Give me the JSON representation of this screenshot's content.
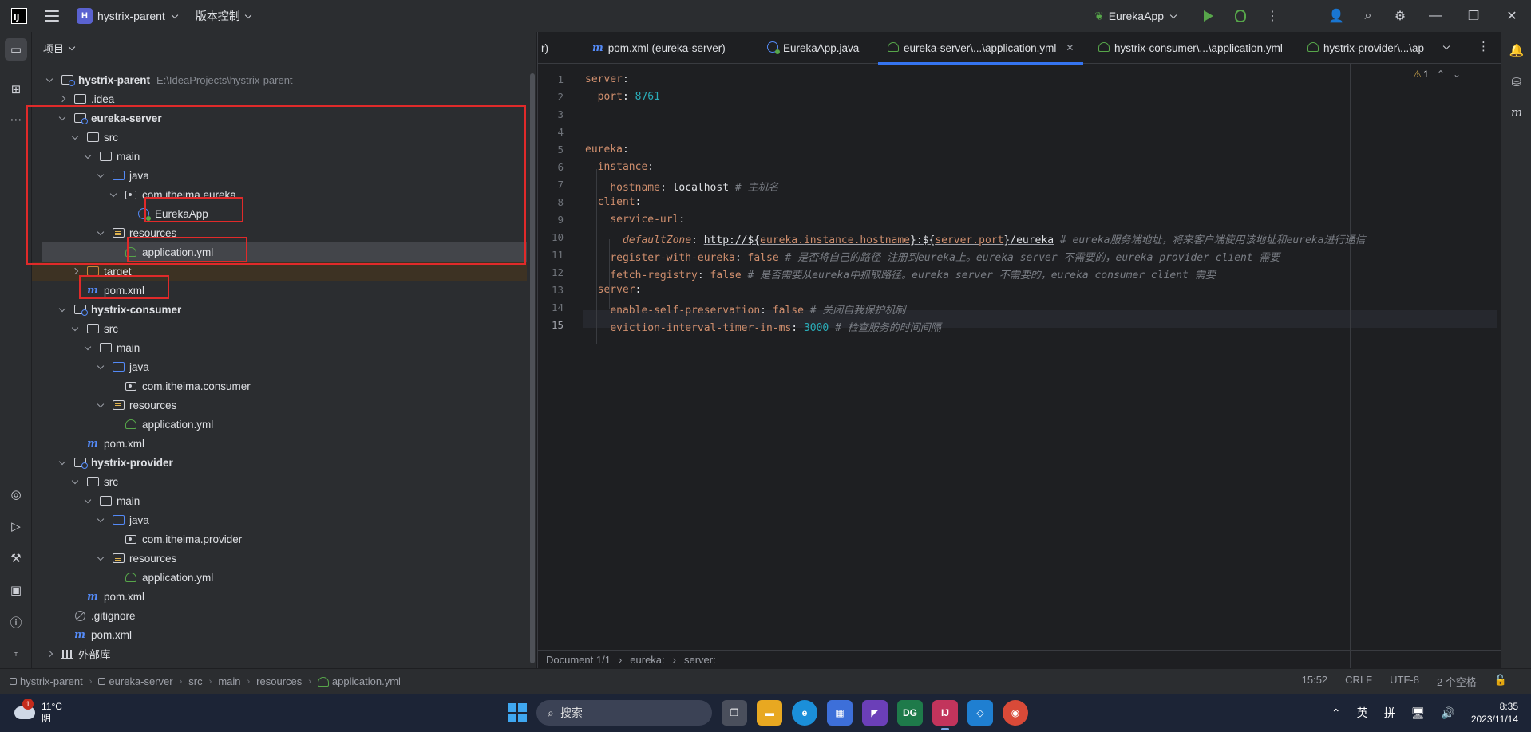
{
  "titlebar": {
    "project_badge": "H",
    "project_name": "hystrix-parent",
    "vcs_label": "版本控制",
    "run_config": "EurekaApp"
  },
  "project_panel": {
    "header": "项目",
    "tree": [
      {
        "label": "hystrix-parent",
        "hint": "E:\\IdeaProjects\\hystrix-parent",
        "icon": "module-folder-icon",
        "depth": 0,
        "expanded": true,
        "bold": true
      },
      {
        "label": ".idea",
        "icon": "folder-icon",
        "depth": 1,
        "expanded": false
      },
      {
        "label": "eureka-server",
        "icon": "module-folder-icon",
        "depth": 1,
        "expanded": true,
        "bold": true
      },
      {
        "label": "src",
        "icon": "folder-icon",
        "depth": 2,
        "expanded": true
      },
      {
        "label": "main",
        "icon": "folder-icon",
        "depth": 3,
        "expanded": true
      },
      {
        "label": "java",
        "icon": "source-folder-icon",
        "depth": 4,
        "expanded": true
      },
      {
        "label": "com.itheima.eureka",
        "icon": "package-icon",
        "depth": 5,
        "expanded": true
      },
      {
        "label": "EurekaApp",
        "icon": "spring-class-icon",
        "depth": 6
      },
      {
        "label": "resources",
        "icon": "resources-folder-icon",
        "depth": 4,
        "expanded": true
      },
      {
        "label": "application.yml",
        "icon": "yaml-file-icon",
        "depth": 5,
        "selected": true
      },
      {
        "label": "target",
        "icon": "excluded-folder-icon",
        "depth": 2,
        "expanded": false,
        "target": true
      },
      {
        "label": "pom.xml",
        "icon": "maven-icon",
        "depth": 2
      },
      {
        "label": "hystrix-consumer",
        "icon": "module-folder-icon",
        "depth": 1,
        "expanded": true,
        "bold": true
      },
      {
        "label": "src",
        "icon": "folder-icon",
        "depth": 2,
        "expanded": true
      },
      {
        "label": "main",
        "icon": "folder-icon",
        "depth": 3,
        "expanded": true
      },
      {
        "label": "java",
        "icon": "source-folder-icon",
        "depth": 4,
        "expanded": true
      },
      {
        "label": "com.itheima.consumer",
        "icon": "package-icon",
        "depth": 5
      },
      {
        "label": "resources",
        "icon": "resources-folder-icon",
        "depth": 4,
        "expanded": true
      },
      {
        "label": "application.yml",
        "icon": "yaml-file-icon",
        "depth": 5
      },
      {
        "label": "pom.xml",
        "icon": "maven-icon",
        "depth": 2
      },
      {
        "label": "hystrix-provider",
        "icon": "module-folder-icon",
        "depth": 1,
        "expanded": true,
        "bold": true
      },
      {
        "label": "src",
        "icon": "folder-icon",
        "depth": 2,
        "expanded": true
      },
      {
        "label": "main",
        "icon": "folder-icon",
        "depth": 3,
        "expanded": true
      },
      {
        "label": "java",
        "icon": "source-folder-icon",
        "depth": 4,
        "expanded": true
      },
      {
        "label": "com.itheima.provider",
        "icon": "package-icon",
        "depth": 5
      },
      {
        "label": "resources",
        "icon": "resources-folder-icon",
        "depth": 4,
        "expanded": true
      },
      {
        "label": "application.yml",
        "icon": "yaml-file-icon",
        "depth": 5
      },
      {
        "label": "pom.xml",
        "icon": "maven-icon",
        "depth": 2
      },
      {
        "label": ".gitignore",
        "icon": "gitignore-icon",
        "depth": 1
      },
      {
        "label": "pom.xml",
        "icon": "maven-icon",
        "depth": 1
      },
      {
        "label": "外部库",
        "icon": "library-icon",
        "depth": 0,
        "expanded": false
      }
    ]
  },
  "editor": {
    "tabs": [
      {
        "label": "r)",
        "icon": ""
      },
      {
        "label": "pom.xml (eureka-server)",
        "icon": "maven-icon"
      },
      {
        "label": "EurekaApp.java",
        "icon": "spring-class-icon"
      },
      {
        "label": "eureka-server\\...\\application.yml",
        "icon": "yaml-file-icon",
        "active": true
      },
      {
        "label": "hystrix-consumer\\...\\application.yml",
        "icon": "yaml-file-icon"
      },
      {
        "label": "hystrix-provider\\...\\ap",
        "icon": "yaml-file-icon"
      }
    ],
    "warnings": "1",
    "current_line": 15,
    "lines": [
      [
        {
          "t": "server",
          "c": "k"
        },
        {
          "t": ":",
          "c": "v"
        }
      ],
      [
        {
          "t": "  "
        },
        {
          "t": "port",
          "c": "k"
        },
        {
          "t": ": ",
          "c": "v"
        },
        {
          "t": "8761",
          "c": "num"
        }
      ],
      [],
      [],
      [
        {
          "t": "eureka",
          "c": "k"
        },
        {
          "t": ":",
          "c": "v"
        }
      ],
      [
        {
          "t": "  "
        },
        {
          "t": "instance",
          "c": "k"
        },
        {
          "t": ":",
          "c": "v"
        }
      ],
      [
        {
          "t": "    "
        },
        {
          "t": "hostname",
          "c": "k"
        },
        {
          "t": ": localhost ",
          "c": "v"
        },
        {
          "t": "# 主机名",
          "c": "cm"
        }
      ],
      [
        {
          "t": "  "
        },
        {
          "t": "client",
          "c": "k"
        },
        {
          "t": ":",
          "c": "v"
        }
      ],
      [
        {
          "t": "    "
        },
        {
          "t": "service-url",
          "c": "k"
        },
        {
          "t": ":",
          "c": "v"
        }
      ],
      [
        {
          "t": "      "
        },
        {
          "t": "defaultZone",
          "c": "k italic"
        },
        {
          "t": ": ",
          "c": "v"
        },
        {
          "t": "http://${",
          "c": "v ul"
        },
        {
          "t": "eureka.instance.hostname",
          "c": "tmpl ul"
        },
        {
          "t": "}:${",
          "c": "v ul"
        },
        {
          "t": "server.port",
          "c": "tmpl ul"
        },
        {
          "t": "}/eureka",
          "c": "v ul"
        },
        {
          "t": " # eureka服务端地址，将来客户端使用该地址和eureka进行通信",
          "c": "cm"
        }
      ],
      [
        {
          "t": "    "
        },
        {
          "t": "register-with-eureka",
          "c": "k"
        },
        {
          "t": ": ",
          "c": "v"
        },
        {
          "t": "false",
          "c": "kf"
        },
        {
          "t": " # 是否将自己的路径 注册到eureka上。eureka server 不需要的，eureka provider client 需要",
          "c": "cm"
        }
      ],
      [
        {
          "t": "    "
        },
        {
          "t": "fetch-registry",
          "c": "k"
        },
        {
          "t": ": ",
          "c": "v"
        },
        {
          "t": "false",
          "c": "kf"
        },
        {
          "t": " # 是否需要从eureka中抓取路径。eureka server 不需要的，eureka consumer client 需要",
          "c": "cm"
        }
      ],
      [
        {
          "t": "  "
        },
        {
          "t": "server",
          "c": "k"
        },
        {
          "t": ":",
          "c": "v"
        }
      ],
      [
        {
          "t": "    "
        },
        {
          "t": "enable-self-preservation",
          "c": "k"
        },
        {
          "t": ": ",
          "c": "v"
        },
        {
          "t": "false",
          "c": "kf"
        },
        {
          "t": " # 关闭自我保护机制",
          "c": "cm"
        }
      ],
      [
        {
          "t": "    "
        },
        {
          "t": "eviction-interval-timer-in-ms",
          "c": "k"
        },
        {
          "t": ": ",
          "c": "v"
        },
        {
          "t": "3000",
          "c": "num"
        },
        {
          "t": " # 检查服务的时间间隔",
          "c": "cm"
        }
      ]
    ],
    "breadcrumb": [
      "Document 1/1",
      "eureka:",
      "server:"
    ]
  },
  "statusbar": {
    "crumbs": [
      "hystrix-parent",
      "eureka-server",
      "src",
      "main",
      "resources",
      "application.yml"
    ],
    "position": "15:52",
    "line_sep": "CRLF",
    "encoding": "UTF-8",
    "indent": "2 个空格"
  },
  "taskbar": {
    "weather_temp": "11°C",
    "weather_desc": "阴",
    "weather_badge": "1",
    "search": "搜索",
    "ime_lang": "英",
    "ime_mode": "拼",
    "time": "8:35",
    "date": "2023/11/14"
  },
  "colors": {
    "accent": "#3574f0",
    "highlight_box": "#e02a2a"
  }
}
